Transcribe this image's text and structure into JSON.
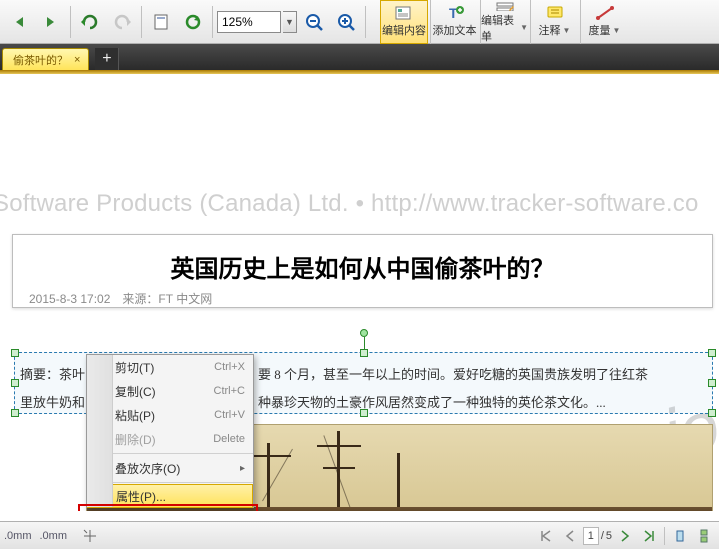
{
  "toolbar": {
    "zoom_value": "125%",
    "edit_content": "编辑内容",
    "add_text": "添加文本",
    "edit_form": "编辑表单",
    "comment": "注释",
    "measure": "度量"
  },
  "tab": {
    "title": "偷茶叶的？",
    "close": "×",
    "add": "+"
  },
  "watermark": "cker Software Products (Canada) Ltd. • http://www.tracker-software.co",
  "wm2": "version",
  "doc": {
    "title": "英国历史上是如何从中国偷茶叶的？",
    "date": "2015-8-3 17:02",
    "source_label": "来源：",
    "source": "FT 中文网",
    "line1_a": "摘要：茶叶",
    "line1_b": "要 8 个月，甚至一年以上的时间。爱好吃糖的英国贵族发明了往红茶",
    "line2_a": "里放牛奶和",
    "line2_b": "种暴珍天物的土豪作风居然变成了一种独特的英伦茶文化。..."
  },
  "menu": {
    "cut": "剪切(T)",
    "cut_sc": "Ctrl+X",
    "copy": "复制(C)",
    "copy_sc": "Ctrl+C",
    "paste": "粘贴(P)",
    "paste_sc": "Ctrl+V",
    "delete": "删除(D)",
    "delete_sc": "Delete",
    "arrange": "叠放次序(O)",
    "props": "属性(P)..."
  },
  "status": {
    "w": ".0mm",
    "h": ".0mm",
    "page_cur": "1",
    "page_sep": "/",
    "page_total": "5"
  }
}
